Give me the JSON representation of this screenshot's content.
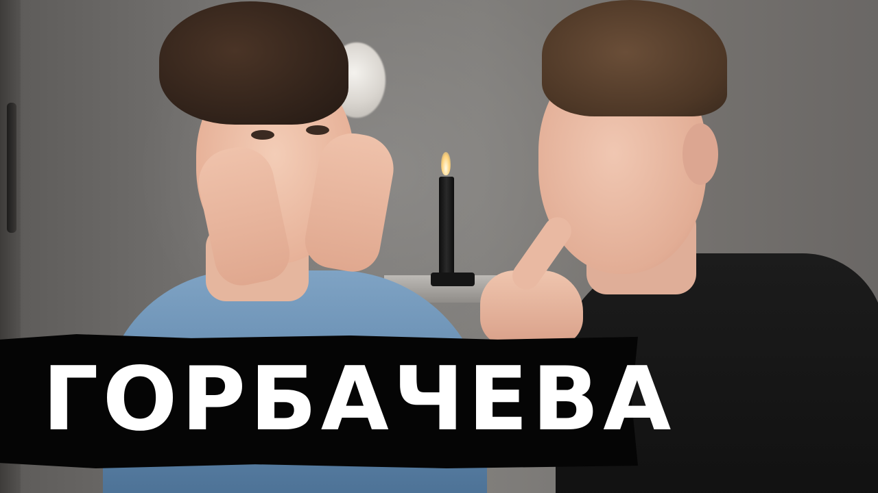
{
  "thumbnail": {
    "title": "ГОРБАЧЕВА"
  },
  "colors": {
    "banner_background": "#050505",
    "title_text": "#ffffff"
  }
}
